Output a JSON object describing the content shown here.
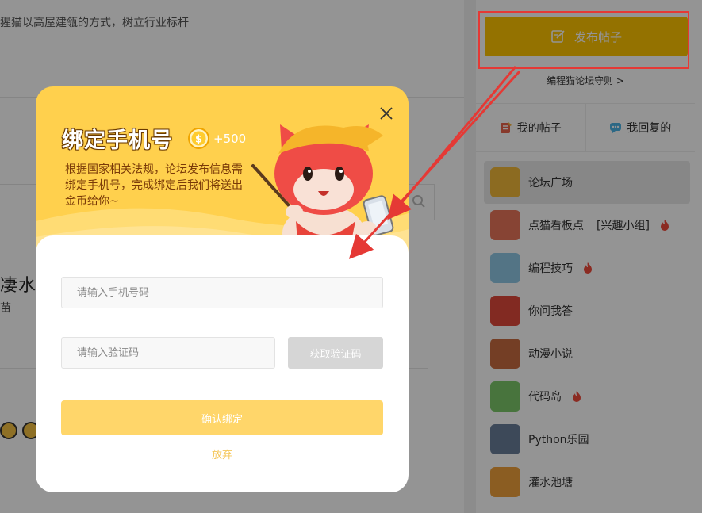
{
  "background": {
    "slogan": "猩猫以高屋建瓴的方式，树立行业标杆",
    "post_title": "凄水电",
    "post_author": "苗"
  },
  "sidebar": {
    "publish_button_label": "发布帖子",
    "rules_link": "编程猫论坛守则 >",
    "tabs": [
      {
        "label": "我的帖子",
        "icon": "post-note-icon"
      },
      {
        "label": "我回复的",
        "icon": "reply-bubble-icon"
      }
    ],
    "forums": [
      {
        "label": "论坛广场",
        "tag": "",
        "hot": false,
        "active": true,
        "thumb_color": "#f1b83a"
      },
      {
        "label": "点猫看板点",
        "tag": "[兴趣小组]",
        "hot": true,
        "active": false,
        "thumb_color": "#e8765a"
      },
      {
        "label": "编程技巧",
        "tag": "",
        "hot": true,
        "active": false,
        "thumb_color": "#8fc8e6"
      },
      {
        "label": "你问我答",
        "tag": "",
        "hot": false,
        "active": false,
        "thumb_color": "#e0493c"
      },
      {
        "label": "动漫小说",
        "tag": "",
        "hot": false,
        "active": false,
        "thumb_color": "#c96b40"
      },
      {
        "label": "代码岛",
        "tag": "",
        "hot": true,
        "active": false,
        "thumb_color": "#7cc96a"
      },
      {
        "label": "Python乐园",
        "tag": "",
        "hot": false,
        "active": false,
        "thumb_color": "#6a7f9a"
      },
      {
        "label": "灌水池塘",
        "tag": "",
        "hot": false,
        "active": false,
        "thumb_color": "#f0a13c"
      }
    ]
  },
  "modal": {
    "title": "绑定手机号",
    "coin_bonus": "+500",
    "description": "根据国家相关法规，论坛发布信息需绑定手机号，完成绑定后我们将送出金币给你~",
    "phone_placeholder": "请输入手机号码",
    "code_placeholder": "请输入验证码",
    "get_code_label": "获取验证码",
    "confirm_label": "确认绑定",
    "abandon_label": "放弃"
  },
  "colors": {
    "modal_header": "#ffd04d",
    "publish_button": "#ffc400",
    "highlight": "#e53935",
    "confirm_button": "#ffd66a"
  }
}
